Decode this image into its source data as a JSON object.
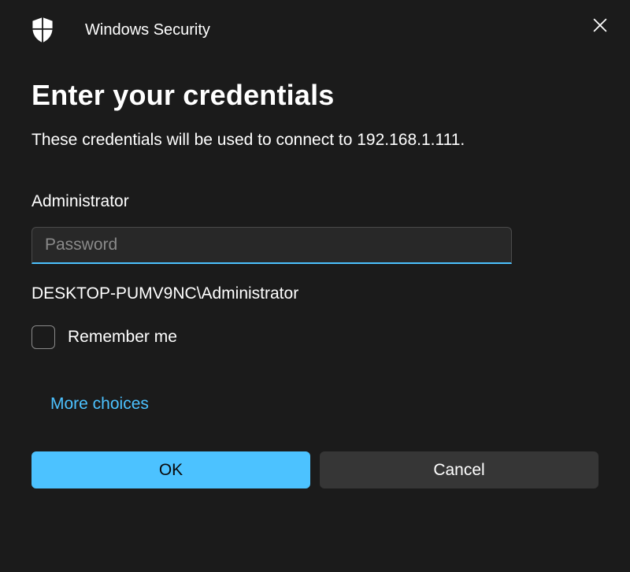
{
  "titlebar": {
    "title": "Windows Security"
  },
  "main": {
    "heading": "Enter your credentials",
    "description": "These credentials will be used to connect to 192.168.1.111.",
    "username": "Administrator",
    "password_placeholder": "Password",
    "password_value": "",
    "domain_user": "DESKTOP-PUMV9NC\\Administrator",
    "remember_label": "Remember me",
    "more_choices_label": "More choices"
  },
  "buttons": {
    "ok": "OK",
    "cancel": "Cancel"
  },
  "colors": {
    "accent": "#4cc2ff",
    "background": "#1b1b1b",
    "input_bg": "#282828",
    "cancel_bg": "#363636"
  }
}
